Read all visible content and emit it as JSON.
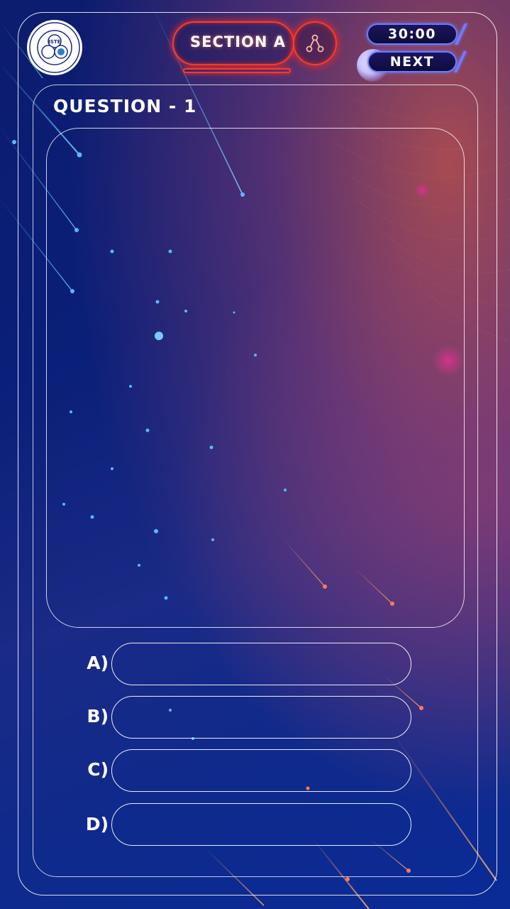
{
  "header": {
    "logo": {
      "center_text": "ISTE",
      "ring_text": "INDIAN SOCIETY FOR TECHNICAL EDUCATION"
    },
    "section_label": "SECTION A",
    "share_icon": "share-nodes-icon",
    "timer": "30:00",
    "next_label": "NEXT"
  },
  "question": {
    "title": "QUESTION - 1"
  },
  "options": [
    {
      "letter": "A)"
    },
    {
      "letter": "B)"
    },
    {
      "letter": "C)"
    },
    {
      "letter": "D)"
    }
  ],
  "colors": {
    "neon_red": "#ff3a2a",
    "chip_border": "#6d7cff",
    "background_blue": "#0c1c6e",
    "background_warm": "#dc5a46"
  }
}
